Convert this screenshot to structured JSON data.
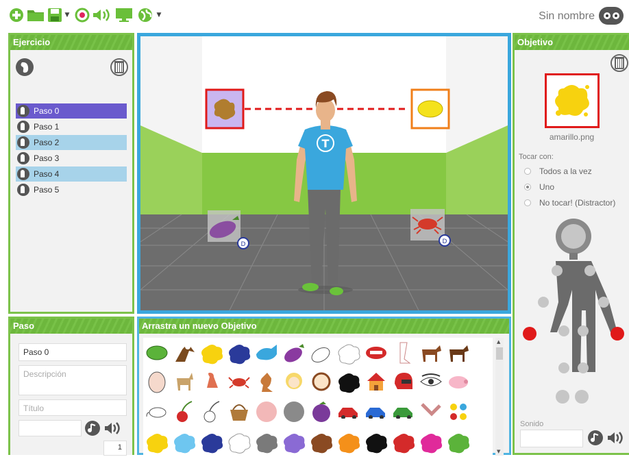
{
  "toolbar": {
    "items": [
      "add-icon",
      "open-folder-icon",
      "save-icon",
      "record-icon",
      "speaker-icon",
      "monitor-icon",
      "globe-icon"
    ],
    "document_name": "Sin nombre"
  },
  "ejercicio": {
    "title": "Ejercicio",
    "steps": [
      "Paso 0",
      "Paso 1",
      "Paso 2",
      "Paso 3",
      "Paso 4",
      "Paso 5"
    ],
    "selected_index": 0
  },
  "stage": {
    "target_left": "mancha marrón",
    "target_right": "limón",
    "distractor_left_label": "D",
    "distractor_right_label": "D",
    "avatar_shirt_letter": "T"
  },
  "paso": {
    "title": "Paso",
    "name_value": "Paso 0",
    "description_placeholder": "Descripción",
    "title_placeholder": "Título",
    "counter": "1"
  },
  "palette": {
    "title": "Arrastra un nuevo Objetivo"
  },
  "objetivo": {
    "title": "Objetivo",
    "file_name": "amarillo.png",
    "touch_label": "Tocar con:",
    "options": [
      "Todos a la vez",
      "Uno",
      "No tocar! (Distractor)"
    ],
    "selected_option": 1,
    "sound_label": "Sonido"
  },
  "colors": {
    "green": "#7cc24a",
    "blue": "#3aa7dd",
    "red_joint": "#e01a1a",
    "purple_sel": "#6a5acd"
  }
}
